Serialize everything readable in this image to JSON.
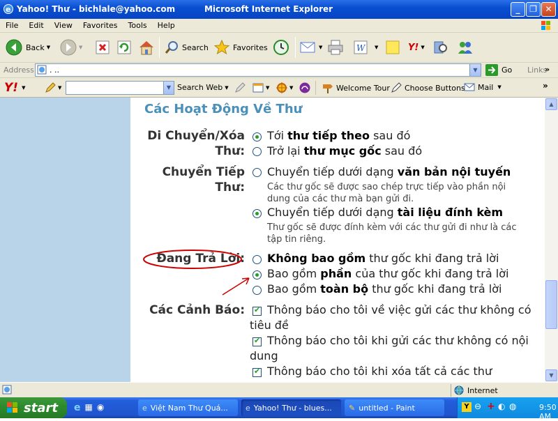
{
  "window": {
    "title": "Yahoo! Thư - bichlale@yahoo.com          Microsoft Internet Explorer"
  },
  "menu": [
    "File",
    "Edit",
    "View",
    "Favorites",
    "Tools",
    "Help"
  ],
  "toolbar": {
    "back": "Back",
    "search": "Search",
    "favorites": "Favorites"
  },
  "address": {
    "label": "Address",
    "value": ".   ..",
    "go": "Go",
    "links": "Links"
  },
  "ytoolbar": {
    "search_web": "Search Web",
    "welcome_tour": "Welcome Tour",
    "choose_buttons": "Choose Buttons",
    "mail": "Mail"
  },
  "content": {
    "section_title": "Các Hoạt Động Về Thư",
    "move_delete": {
      "label_line1": "Di Chuyển/Xóa",
      "label_line2": "Thư:",
      "opt1_pre": "Tới ",
      "opt1_bold": "thư tiếp theo",
      "opt1_post": " sau đó",
      "opt2_pre": "Trở lại ",
      "opt2_bold": "thư mục gốc",
      "opt2_post": " sau đó"
    },
    "forward": {
      "label_line1": "Chuyển Tiếp",
      "label_line2": "Thư:",
      "opt1_pre": "Chuyển tiếp dưới dạng ",
      "opt1_bold": "văn bản nội tuyến",
      "opt1_desc1": "Các thư gốc sẽ được sao chép trực tiếp vào phần nội",
      "opt1_desc2": "dung của các thư mà bạn gửi đi.",
      "opt2_pre": "Chuyển tiếp dưới dạng ",
      "opt2_bold": "tài liệu đính kèm",
      "opt2_desc1": "Thư gốc sẽ được đính kèm với các thư gửi đi như là các",
      "opt2_desc2": "tập tin riêng."
    },
    "reply": {
      "label": "Đang Trả Lời:",
      "opt1_bold": "Không bao gồm",
      "opt1_post": " thư gốc khi đang trả lời",
      "opt2_pre": "Bao gồm ",
      "opt2_bold": "phần",
      "opt2_post": " của thư gốc khi đang trả lời",
      "opt3_pre": "Bao gồm ",
      "opt3_bold": "toàn bộ",
      "opt3_post": " thư gốc khi đang trả lời"
    },
    "alerts": {
      "label": "Các Cảnh Báo:",
      "opt1_line1": "Thông báo cho tôi về việc gửi các thư không có",
      "opt1_line2": "tiêu đề",
      "opt2_line1": "Thông báo cho tôi khi gửi các thư không có nội",
      "opt2_line2": "dung",
      "opt3_line1": "Thông báo cho tôi khi xóa tất cả các thư"
    }
  },
  "status": {
    "zone": "Internet"
  },
  "taskbar": {
    "start": "start",
    "tasks": [
      "Việt Nam Thư Quá...",
      "Yahoo! Thư - blues...",
      "untitled - Paint"
    ],
    "clock": "9:50 AM"
  },
  "colors": {
    "accent": "#4a90b8",
    "left_panel": "#b9d3e8",
    "annotation": "#cc0000"
  }
}
